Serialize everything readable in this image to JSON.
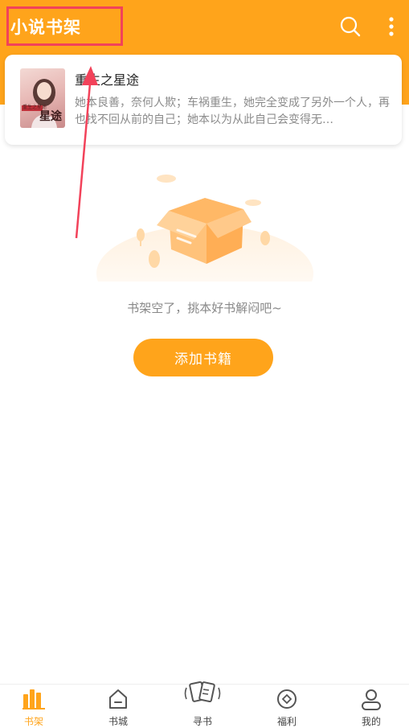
{
  "header": {
    "title": "小说书架",
    "search_icon": "search-icon",
    "more_icon": "more-vertical-icon",
    "background_color": "#FFA41B"
  },
  "bookshelf": {
    "books": [
      {
        "title": "重生之星途",
        "description": "她本良善，奈何人欺；车祸重生，她完全变成了另外一个人，再也找不回从前的自己；她本以为从此自己会变得无…",
        "cover_title": "星途",
        "cover_subtitle": "重生之星途"
      }
    ]
  },
  "empty_state": {
    "icon": "empty-box-illustration",
    "message": "书架空了，挑本好书解闷吧~",
    "add_button_label": "添加书籍"
  },
  "bottom_nav": {
    "items": [
      {
        "label": "书架",
        "icon": "bookshelf-icon",
        "active": true
      },
      {
        "label": "书城",
        "icon": "bookstore-icon",
        "active": false
      },
      {
        "label": "寻书",
        "icon": "find-book-icon",
        "active": false
      },
      {
        "label": "福利",
        "icon": "coin-icon",
        "active": false
      },
      {
        "label": "我的",
        "icon": "profile-icon",
        "active": false
      }
    ],
    "active_color": "#FFA41B"
  },
  "annotation_color": "#F2425A"
}
